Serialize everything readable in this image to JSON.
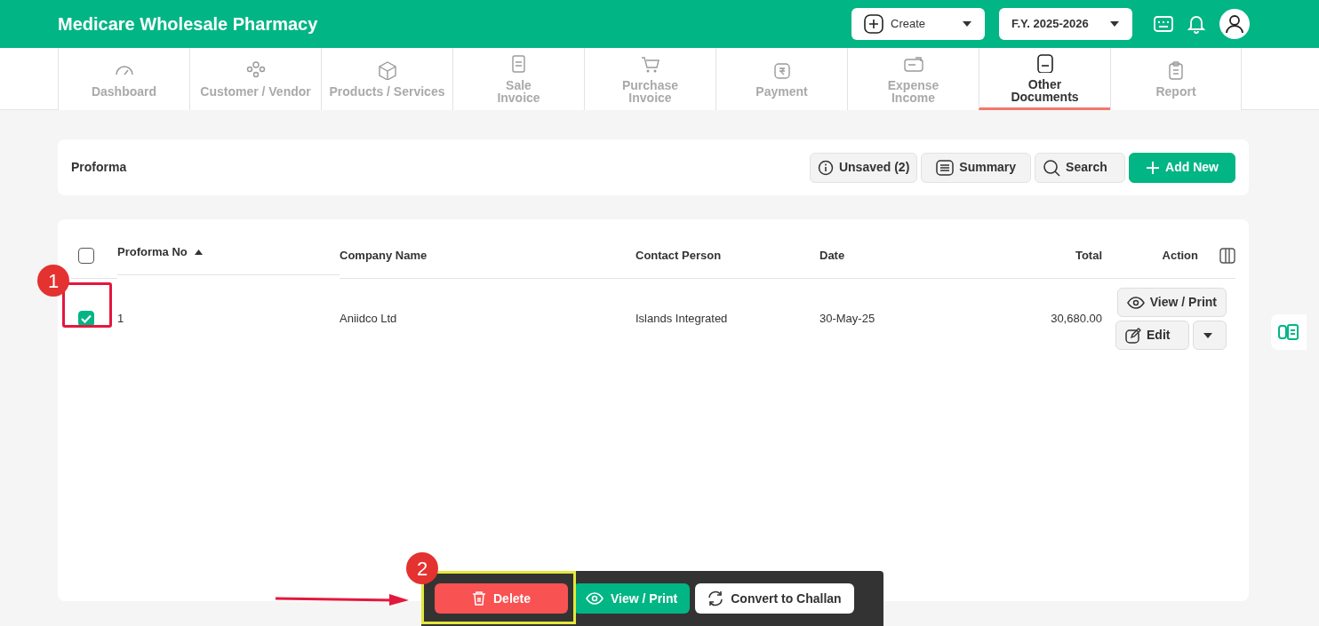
{
  "app_title": "Medicare Wholesale Pharmacy",
  "header": {
    "create_label": "Create",
    "fiscal_year": "F.Y. 2025-2026"
  },
  "nav_tabs": [
    {
      "label": "Dashboard",
      "selected": false
    },
    {
      "label": "Customer / Vendor",
      "selected": false
    },
    {
      "label": "Products / Services",
      "selected": false
    },
    {
      "label": "Sale\nInvoice",
      "selected": false
    },
    {
      "label": "Purchase\nInvoice",
      "selected": false
    },
    {
      "label": "Payment",
      "selected": false
    },
    {
      "label": "Expense\nIncome",
      "selected": false
    },
    {
      "label": "Other\nDocuments",
      "selected": true
    },
    {
      "label": "Report",
      "selected": false
    }
  ],
  "page_title": "Proforma",
  "toolbar_buttons": [
    {
      "label": "Unsaved (2)",
      "kind": "info"
    },
    {
      "label": "Summary",
      "kind": "summary"
    },
    {
      "label": "Search",
      "kind": "search"
    },
    {
      "label": "Add New",
      "kind": "add"
    }
  ],
  "table": {
    "select_all_checked": false,
    "columns": [
      {
        "label": "Proforma No",
        "sorted": true
      },
      {
        "label": "Company Name",
        "sorted": false
      },
      {
        "label": "Contact Person",
        "sorted": false
      },
      {
        "label": "Date",
        "sorted": false
      },
      {
        "label": "Total",
        "sorted": false
      },
      {
        "label": "Action",
        "sorted": false
      }
    ],
    "rows": [
      {
        "selected": true,
        "cells": [
          "1",
          "Aniidco Ltd",
          "Islands Integrated",
          "30-May-25",
          "30,680.00"
        ],
        "actions": [
          "View / Print",
          "Edit"
        ]
      }
    ]
  },
  "bulk_actions": [
    {
      "label": "Delete",
      "kind": "danger"
    },
    {
      "label": "View / Print",
      "kind": "view"
    },
    {
      "label": "Convert to Challan",
      "kind": "convert"
    }
  ],
  "annotations": [
    {
      "number": "1"
    },
    {
      "number": "2"
    }
  ]
}
